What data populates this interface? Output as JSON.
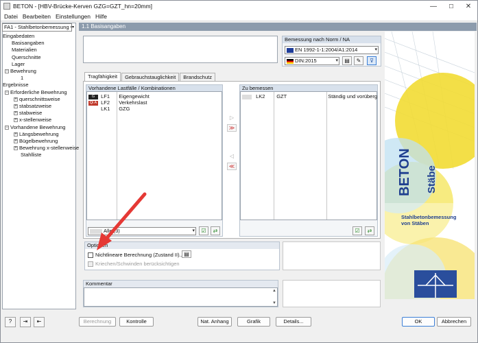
{
  "window": {
    "title": "BETON - [HBV-Brücke-Kerven GZG=GZT_hn=20mm]",
    "minimize": "—",
    "maximize": "☐",
    "close": "✕"
  },
  "menu": [
    "Datei",
    "Bearbeiten",
    "Einstellungen",
    "Hilfe"
  ],
  "nav": {
    "case_select": "FA1 - Stahlbetonbemessung vo",
    "tree": [
      {
        "label": "Eingabedaten",
        "level": 0,
        "toggle": "−"
      },
      {
        "label": "Basisangaben",
        "level": 1
      },
      {
        "label": "Materialien",
        "level": 1
      },
      {
        "label": "Querschnitte",
        "level": 1
      },
      {
        "label": "Lager",
        "level": 1
      },
      {
        "label": "Bewehrung",
        "level": 1,
        "toggle": "−"
      },
      {
        "label": "1",
        "level": 2
      },
      {
        "label": "Ergebnisse",
        "level": 0,
        "toggle": "−"
      },
      {
        "label": "Erforderliche Bewehrung",
        "level": 1,
        "toggle": "−"
      },
      {
        "label": "querschnittsweise",
        "level": 2,
        "toggle": "+"
      },
      {
        "label": "stabsatzweise",
        "level": 2,
        "toggle": "+"
      },
      {
        "label": "stabweise",
        "level": 2,
        "toggle": "+"
      },
      {
        "label": "x-stellenweise",
        "level": 2,
        "toggle": "+"
      },
      {
        "label": "Vorhandene Bewehrung",
        "level": 1,
        "toggle": "−"
      },
      {
        "label": "Längsbewehrung",
        "level": 2,
        "toggle": "+"
      },
      {
        "label": "Bügelbewehrung",
        "level": 2,
        "toggle": "+"
      },
      {
        "label": "Bewehrung x-stellenweise",
        "level": 2,
        "toggle": "+"
      },
      {
        "label": "Stahlliste",
        "level": 2
      }
    ]
  },
  "section_title": "1.1 Basisangaben",
  "norm": {
    "title": "Bemessung nach Norm / NA",
    "standard": "EN 1992-1-1:2004/A1:2014",
    "annex": "DIN:2015"
  },
  "tabs": [
    "Tragfähigkeit",
    "Gebrauchstauglichkeit",
    "Brandschutz"
  ],
  "existing": {
    "title": "Vorhandene Lastfälle / Kombinationen",
    "rows": [
      {
        "tag": "G",
        "tag_color": "#222222",
        "id": "LF1",
        "name": "Eigengewicht"
      },
      {
        "tag": "Qi A",
        "tag_color": "#c0392b",
        "id": "LF2",
        "name": "Verkehrslast"
      },
      {
        "tag": "",
        "tag_color": "#ffffff",
        "id": "LK1",
        "name": "GZG"
      }
    ],
    "filter": "Alle (3)"
  },
  "to_design": {
    "title": "Zu bemessen",
    "rows": [
      {
        "id": "LK2",
        "name": "GZT",
        "type": "Ständig und vorüberg"
      }
    ]
  },
  "move": {
    "add": "▷",
    "add_all": "≫",
    "remove": "◁",
    "remove_all": "≪"
  },
  "options": {
    "title": "Optionen",
    "nonlinear": "Nichtlineare Berechnung (Zustand II)...",
    "creep": "Kriechen/Schwinden berücksichtigen"
  },
  "comment": {
    "title": "Kommentar",
    "text": ""
  },
  "side_image": {
    "brand": "BETON",
    "sub": "Stäbe",
    "caption_line1": "Stahlbetonbemessung",
    "caption_line2": "von Stäben"
  },
  "buttons": {
    "berechnung": "Berechnung",
    "kontrolle": "Kontrolle",
    "nat_anhang": "Nat. Anhang",
    "grafik": "Grafik",
    "details": "Details...",
    "ok": "OK",
    "abbrechen": "Abbrechen"
  },
  "colors": {
    "header": "#8c9bac",
    "accent": "#e53935",
    "ok_border": "#3c7fd6"
  }
}
